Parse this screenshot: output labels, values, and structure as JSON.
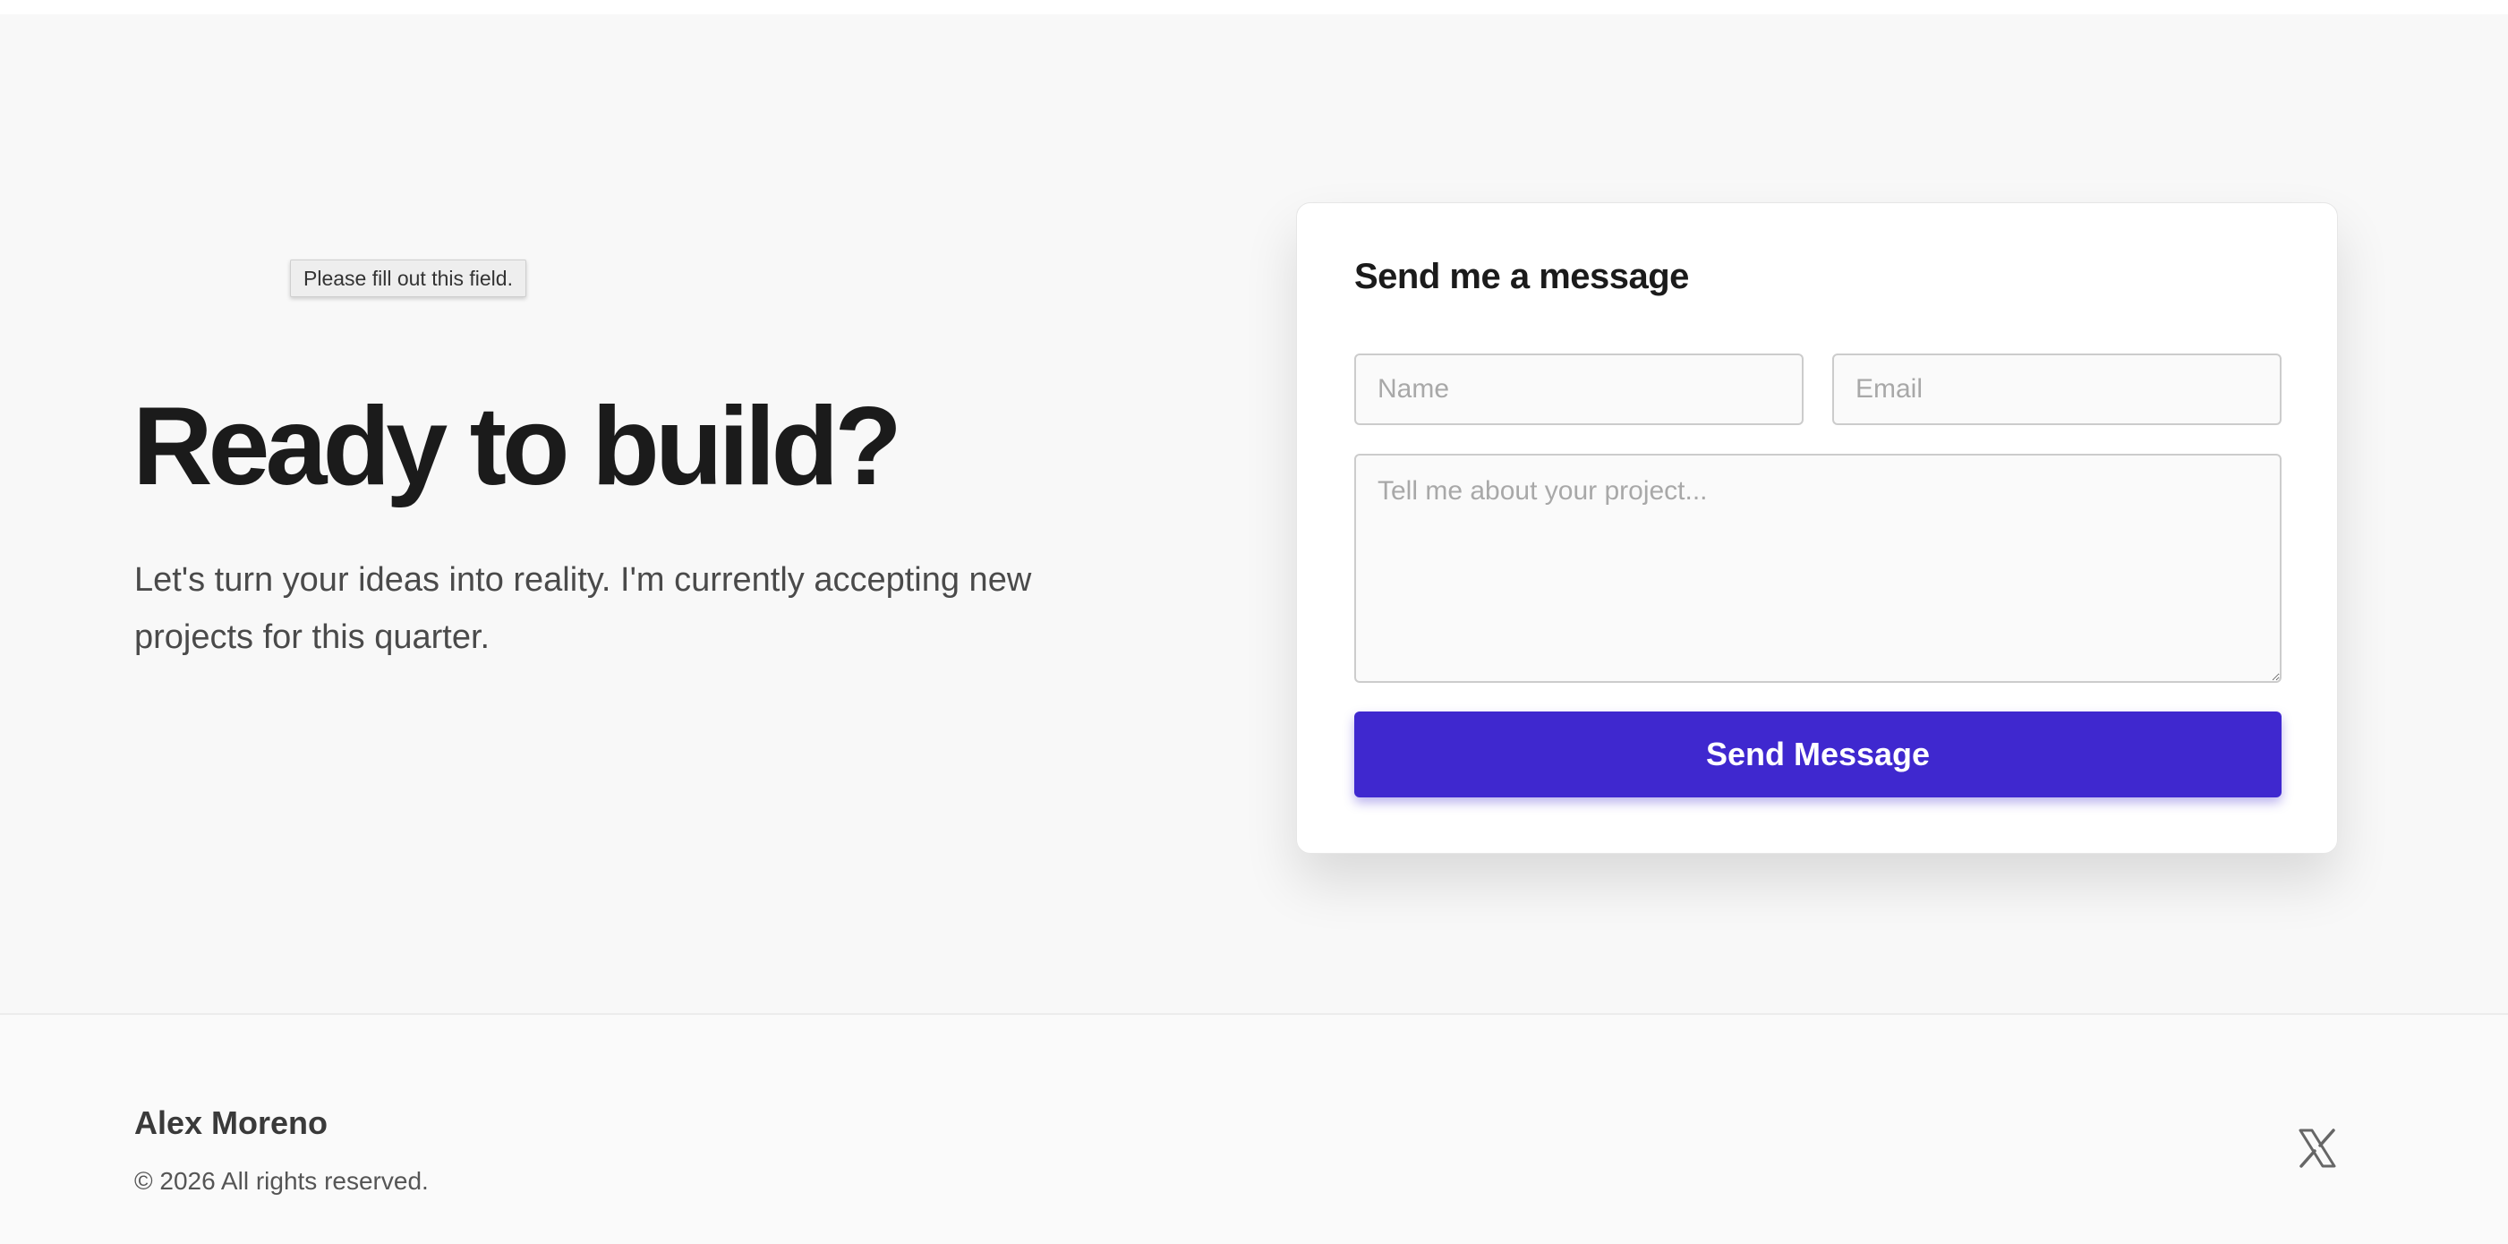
{
  "tooltip": {
    "text": "Please fill out this field."
  },
  "hero": {
    "headline": "Ready to build?",
    "subtext": "Let's turn your ideas into reality. I'm currently accepting new projects for this quarter."
  },
  "contact_form": {
    "title": "Send me a message",
    "name_placeholder": "Name",
    "email_placeholder": "Email",
    "message_placeholder": "Tell me about your project...",
    "submit_label": "Send Message"
  },
  "footer": {
    "name": "Alex Moreno",
    "copyright": "© 2026 All rights reserved.",
    "social_icon": "x-logo-icon"
  },
  "colors": {
    "accent": "#3f28cf",
    "background": "#f8f8f8",
    "card": "#ffffff",
    "heading": "#1b1b1b",
    "body_text": "#4a4a4a"
  }
}
